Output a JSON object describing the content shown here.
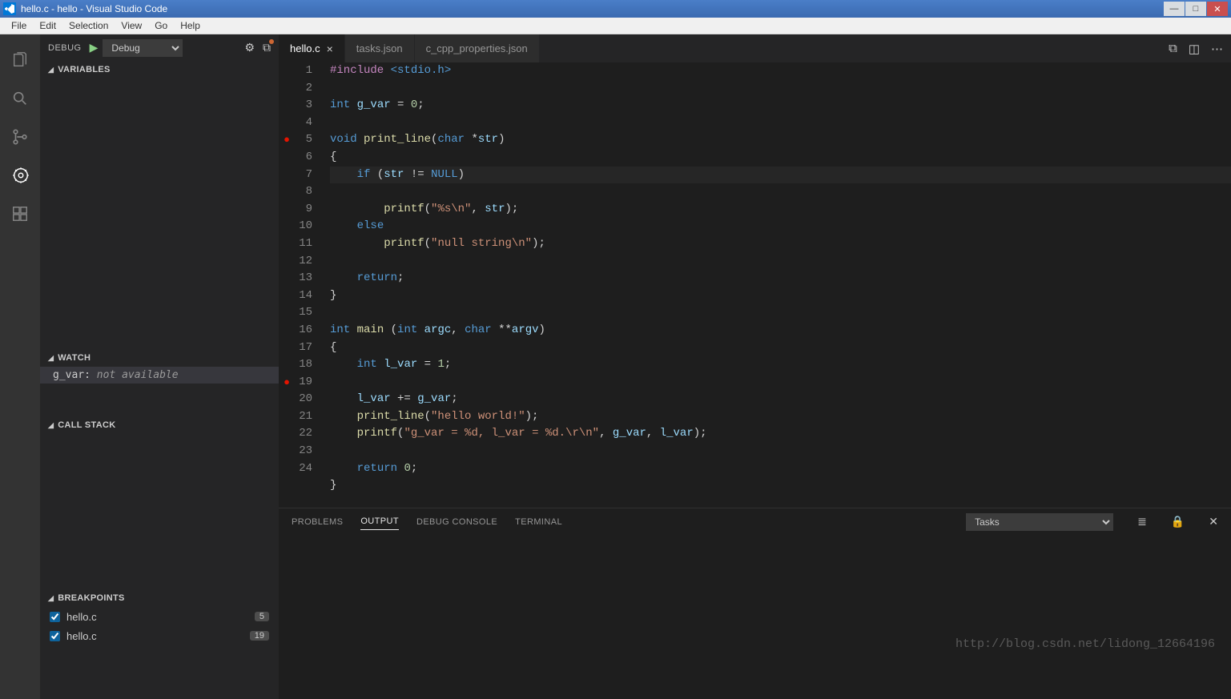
{
  "titlebar": {
    "title": "hello.c - hello - Visual Studio Code"
  },
  "menubar": {
    "items": [
      "File",
      "Edit",
      "Selection",
      "View",
      "Go",
      "Help"
    ]
  },
  "activitybar": {
    "items": [
      {
        "name": "explorer-icon"
      },
      {
        "name": "search-icon"
      },
      {
        "name": "source-control-icon"
      },
      {
        "name": "debug-icon"
      },
      {
        "name": "extensions-icon"
      }
    ]
  },
  "debug": {
    "header_label": "DEBUG",
    "config": "Debug",
    "sections": {
      "variables": "VARIABLES",
      "watch": "WATCH",
      "callstack": "CALL STACK",
      "breakpoints": "BREAKPOINTS"
    },
    "watch": {
      "expr": "g_var:",
      "value": "not available"
    },
    "breakpoints": [
      {
        "file": "hello.c",
        "line": "5",
        "checked": true
      },
      {
        "file": "hello.c",
        "line": "19",
        "checked": true
      }
    ]
  },
  "tabs": [
    {
      "label": "hello.c",
      "active": true
    },
    {
      "label": "tasks.json",
      "active": false
    },
    {
      "label": "c_cpp_properties.json",
      "active": false
    }
  ],
  "editor": {
    "linecount": 24,
    "breakpoint_lines": [
      5,
      19
    ],
    "highlight_line": 7,
    "lines": [
      [
        [
          "inc",
          "#include "
        ],
        [
          "hdr",
          "<stdio.h>"
        ]
      ],
      [],
      [
        [
          "type",
          "int"
        ],
        [
          "op",
          " "
        ],
        [
          "var",
          "g_var"
        ],
        [
          "op",
          " = "
        ],
        [
          "num",
          "0"
        ],
        [
          "op",
          ";"
        ]
      ],
      [],
      [
        [
          "type",
          "void"
        ],
        [
          "op",
          " "
        ],
        [
          "fn",
          "print_line"
        ],
        [
          "op",
          "("
        ],
        [
          "type",
          "char"
        ],
        [
          "op",
          " *"
        ],
        [
          "var",
          "str"
        ],
        [
          "op",
          ")"
        ]
      ],
      [
        [
          "op",
          "{"
        ]
      ],
      [
        [
          "op",
          "    "
        ],
        [
          "kw",
          "if"
        ],
        [
          "op",
          " ("
        ],
        [
          "var",
          "str"
        ],
        [
          "op",
          " != "
        ],
        [
          "const",
          "NULL"
        ],
        [
          "op",
          ")"
        ]
      ],
      [
        [
          "op",
          "        "
        ],
        [
          "fn",
          "printf"
        ],
        [
          "op",
          "("
        ],
        [
          "str",
          "\"%s\\n\""
        ],
        [
          "op",
          ", "
        ],
        [
          "var",
          "str"
        ],
        [
          "op",
          ");"
        ]
      ],
      [
        [
          "op",
          "    "
        ],
        [
          "kw",
          "else"
        ]
      ],
      [
        [
          "op",
          "        "
        ],
        [
          "fn",
          "printf"
        ],
        [
          "op",
          "("
        ],
        [
          "str",
          "\"null string\\n\""
        ],
        [
          "op",
          ");"
        ]
      ],
      [],
      [
        [
          "op",
          "    "
        ],
        [
          "kw",
          "return"
        ],
        [
          "op",
          ";"
        ]
      ],
      [
        [
          "op",
          "}"
        ]
      ],
      [],
      [
        [
          "type",
          "int"
        ],
        [
          "op",
          " "
        ],
        [
          "fn",
          "main"
        ],
        [
          "op",
          " ("
        ],
        [
          "type",
          "int"
        ],
        [
          "op",
          " "
        ],
        [
          "var",
          "argc"
        ],
        [
          "op",
          ", "
        ],
        [
          "type",
          "char"
        ],
        [
          "op",
          " **"
        ],
        [
          "var",
          "argv"
        ],
        [
          "op",
          ")"
        ]
      ],
      [
        [
          "op",
          "{"
        ]
      ],
      [
        [
          "op",
          "    "
        ],
        [
          "type",
          "int"
        ],
        [
          "op",
          " "
        ],
        [
          "var",
          "l_var"
        ],
        [
          "op",
          " = "
        ],
        [
          "num",
          "1"
        ],
        [
          "op",
          ";"
        ]
      ],
      [],
      [
        [
          "op",
          "    "
        ],
        [
          "var",
          "l_var"
        ],
        [
          "op",
          " += "
        ],
        [
          "var",
          "g_var"
        ],
        [
          "op",
          ";"
        ]
      ],
      [
        [
          "op",
          "    "
        ],
        [
          "fn",
          "print_line"
        ],
        [
          "op",
          "("
        ],
        [
          "str",
          "\"hello world!\""
        ],
        [
          "op",
          ");"
        ]
      ],
      [
        [
          "op",
          "    "
        ],
        [
          "fn",
          "printf"
        ],
        [
          "op",
          "("
        ],
        [
          "str",
          "\"g_var = %d, l_var = %d.\\r\\n\""
        ],
        [
          "op",
          ", "
        ],
        [
          "var",
          "g_var"
        ],
        [
          "op",
          ", "
        ],
        [
          "var",
          "l_var"
        ],
        [
          "op",
          ");"
        ]
      ],
      [],
      [
        [
          "op",
          "    "
        ],
        [
          "kw",
          "return"
        ],
        [
          "op",
          " "
        ],
        [
          "num",
          "0"
        ],
        [
          "op",
          ";"
        ]
      ],
      [
        [
          "op",
          "}"
        ]
      ]
    ]
  },
  "panel": {
    "tabs": [
      "PROBLEMS",
      "OUTPUT",
      "DEBUG CONSOLE",
      "TERMINAL"
    ],
    "active": "OUTPUT",
    "selector": "Tasks"
  },
  "watermark": "http://blog.csdn.net/lidong_12664196"
}
